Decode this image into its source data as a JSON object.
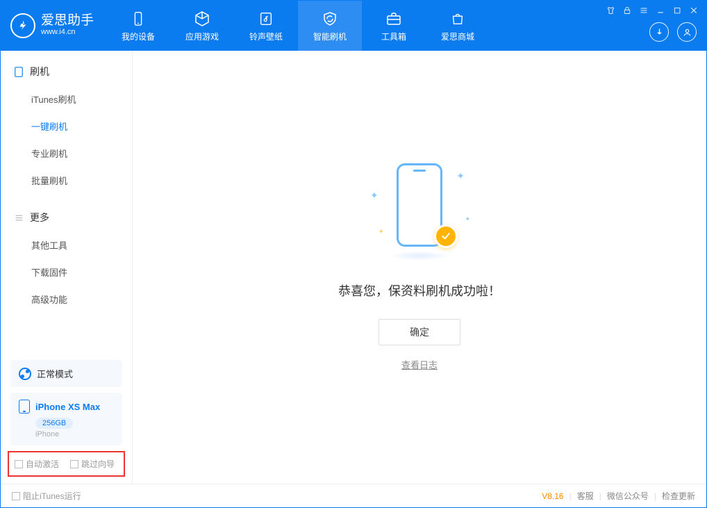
{
  "app": {
    "name_cn": "爱思助手",
    "name_en": "www.i4.cn"
  },
  "nav": {
    "items": [
      {
        "label": "我的设备"
      },
      {
        "label": "应用游戏"
      },
      {
        "label": "铃声壁纸"
      },
      {
        "label": "智能刷机"
      },
      {
        "label": "工具箱"
      },
      {
        "label": "爱思商城"
      }
    ]
  },
  "sidebar": {
    "section1_title": "刷机",
    "section1_items": [
      "iTunes刷机",
      "一键刷机",
      "专业刷机",
      "批量刷机"
    ],
    "section2_title": "更多",
    "section2_items": [
      "其他工具",
      "下载固件",
      "高级功能"
    ],
    "mode_label": "正常模式",
    "device": {
      "name": "iPhone XS Max",
      "storage": "256GB",
      "type": "iPhone"
    },
    "opt_auto_activate": "自动激活",
    "opt_skip_guide": "跳过向导"
  },
  "main": {
    "success_text": "恭喜您，保资料刷机成功啦！",
    "ok_button": "确定",
    "log_link": "查看日志"
  },
  "footer": {
    "block_itunes": "阻止iTunes运行",
    "version": "V8.16",
    "links": [
      "客服",
      "微信公众号",
      "检查更新"
    ]
  }
}
